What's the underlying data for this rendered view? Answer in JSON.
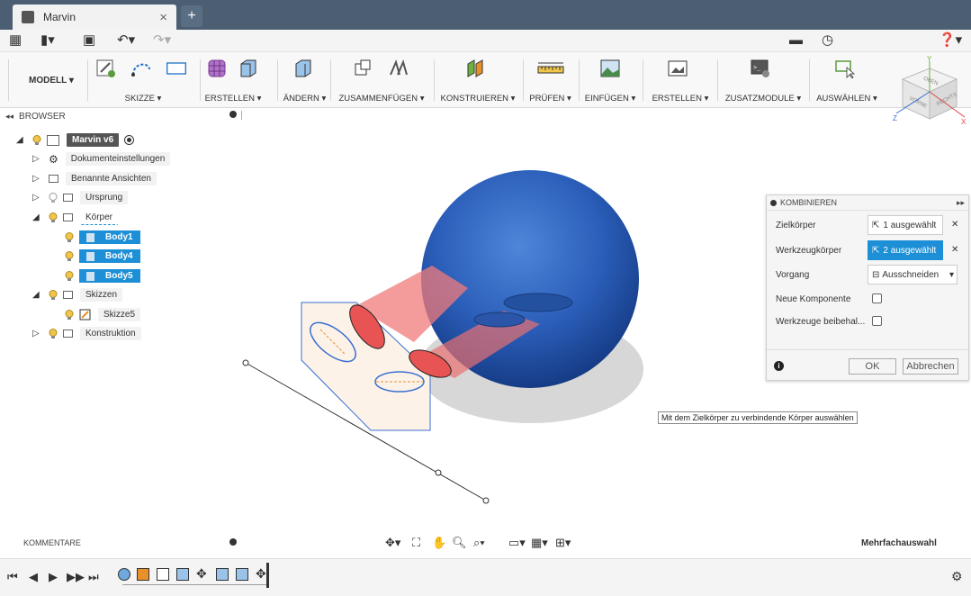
{
  "window": {
    "tab_title": "Marvin",
    "new_tab": "+",
    "close": "×"
  },
  "ribbon": {
    "workspace": "MODELL ▾",
    "groups": [
      "SKIZZE ▾",
      "ERSTELLEN ▾",
      "ÄNDERN ▾",
      "ZUSAMMENFÜGEN ▾",
      "KONSTRUIEREN ▾",
      "PRÜFEN ▾",
      "EINFÜGEN ▾",
      "ERSTELLEN ▾",
      "ZUSATZMODULE ▾",
      "AUSWÄHLEN ▾"
    ]
  },
  "viewcube": {
    "top": "OBEN",
    "front": "VORNE",
    "right": "RECHTS",
    "x": "X",
    "y": "Y",
    "z": "Z"
  },
  "browser": {
    "title": "BROWSER",
    "root": "Marvin v6",
    "items": [
      {
        "label": "Dokumenteinstellungen"
      },
      {
        "label": "Benannte Ansichten"
      },
      {
        "label": "Ursprung"
      },
      {
        "label": "Körper"
      },
      {
        "label": "Body1"
      },
      {
        "label": "Body4"
      },
      {
        "label": "Body5"
      },
      {
        "label": "Skizzen"
      },
      {
        "label": "Skizze5"
      },
      {
        "label": "Konstruktion"
      }
    ]
  },
  "dialog": {
    "title": "KOMBINIEREN",
    "rows": [
      {
        "label": "Zielkörper",
        "value": "1 ausgewählt"
      },
      {
        "label": "Werkzeugkörper",
        "value": "2 ausgewählt"
      },
      {
        "label": "Vorgang",
        "value": "Ausschneiden"
      },
      {
        "label": "Neue Komponente"
      },
      {
        "label": "Werkzeuge beibehal..."
      }
    ],
    "ok": "OK",
    "cancel": "Abbrechen"
  },
  "tooltip": "Mit dem Zielkörper zu verbindende Körper auswählen",
  "comments": "KOMMENTARE",
  "status": "Mehrfachauswahl",
  "colors": {
    "accent": "#1d8fd6",
    "sphere": "#2d62b8",
    "topbar": "#4b5e72"
  }
}
